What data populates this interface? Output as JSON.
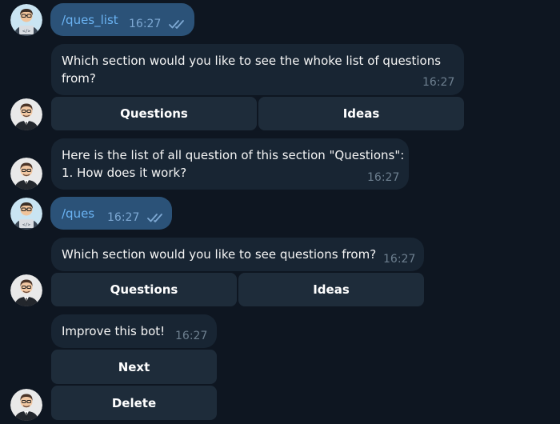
{
  "messages": [
    {
      "sender": "user",
      "text": "/ques_list",
      "time": "16:27",
      "status": "read"
    },
    {
      "sender": "bot",
      "text": [
        "Which section would you like to see the whoke list of questions",
        "from?"
      ],
      "time": "16:27",
      "buttons": [
        "Questions",
        "Ideas"
      ]
    },
    {
      "sender": "bot",
      "text": [
        "Here is the list of all question of this section \"Questions\":",
        "1. How does it work?"
      ],
      "time": "16:27"
    },
    {
      "sender": "user",
      "text": "/ques",
      "time": "16:27",
      "status": "read"
    },
    {
      "sender": "bot",
      "text": [
        "Which section would you like to see questions from?"
      ],
      "time": "16:27",
      "buttons": [
        "Questions",
        "Ideas"
      ]
    },
    {
      "sender": "bot",
      "text": [
        "Improve this bot!"
      ],
      "time": "16:27",
      "buttons": [
        "Next",
        "Delete"
      ]
    }
  ],
  "colors": {
    "background": "#0e1621",
    "outgoing_bubble": "#2b5278",
    "incoming_bubble": "#182533",
    "keyboard_button": "#1e2c3a",
    "command_link": "#6ab3f3"
  },
  "icons": {
    "user_avatar": "developer-avatar-icon",
    "bot_avatar": "businessman-avatar-icon",
    "read_status": "double-check-icon"
  }
}
